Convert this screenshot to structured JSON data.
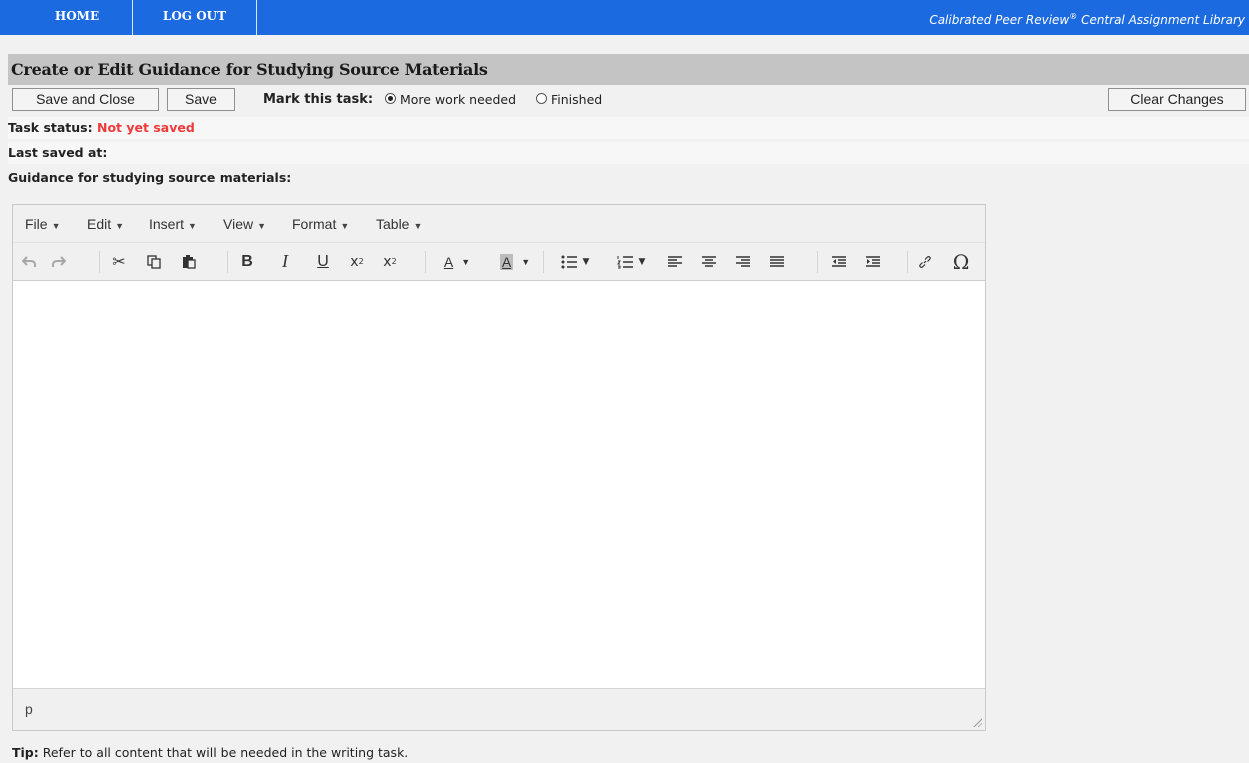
{
  "nav": {
    "home": "HOME",
    "logout": "LOG OUT",
    "brand_text": "Calibrated Peer Review",
    "brand_sup": "®",
    "brand_suffix": " Central Assignment Library"
  },
  "page": {
    "title": "Create or Edit Guidance for Studying Source Materials"
  },
  "actions": {
    "save_close_label": "Save and Close",
    "save_label": "Save",
    "mark_label": "Mark this task:",
    "option_more": "More work needed",
    "option_finished": "Finished",
    "selected_option": "More work needed",
    "clear_label": "Clear Changes"
  },
  "status": {
    "task_status_label": "Task status:",
    "task_status_value": "Not yet saved",
    "last_saved_label": "Last saved at:",
    "guidance_label": "Guidance for studying source materials:"
  },
  "editor": {
    "menus": [
      "File",
      "Edit",
      "Insert",
      "View",
      "Format",
      "Table"
    ],
    "icons": [
      "undo-icon",
      "redo-icon",
      "cut-icon",
      "copy-icon",
      "paste-icon",
      "bold-icon",
      "italic-icon",
      "underline-icon",
      "subscript-icon",
      "superscript-icon",
      "text-color-icon",
      "background-color-icon",
      "bullet-list-icon",
      "numbered-list-icon",
      "align-left-icon",
      "align-center-icon",
      "align-right-icon",
      "align-justify-icon",
      "outdent-icon",
      "indent-icon",
      "link-icon",
      "special-character-icon"
    ],
    "path": "p"
  },
  "tip": {
    "label": "Tip:",
    "text": " Refer to all content that will be needed in the writing task."
  },
  "colors": {
    "nav_bg": "#1c6ae0",
    "title_bg": "#c4c4c4",
    "status_red": "#ef3a3a"
  }
}
